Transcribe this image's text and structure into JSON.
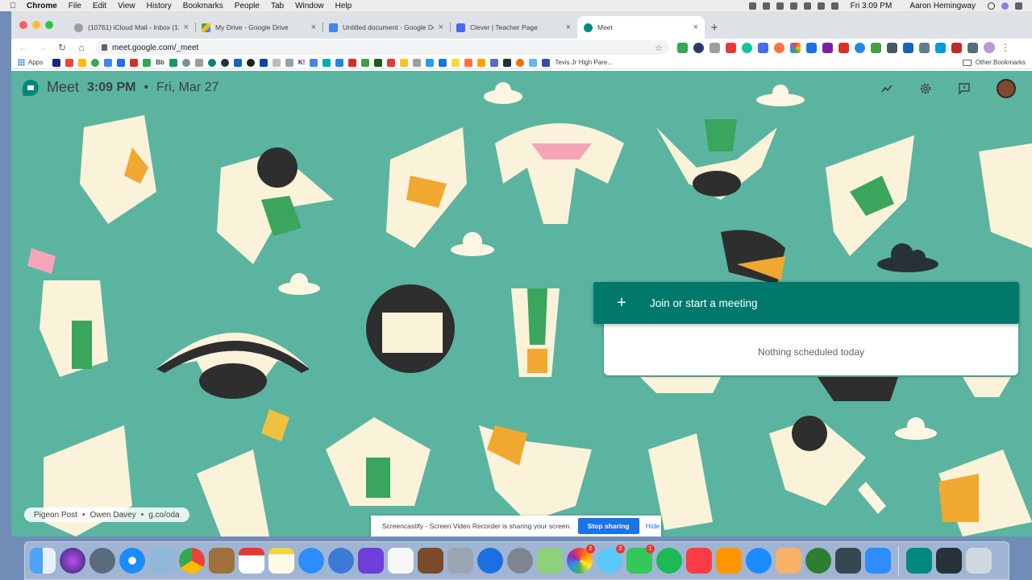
{
  "menubar": {
    "apple_icon": "apple-icon",
    "items": [
      "Chrome",
      "File",
      "Edit",
      "View",
      "History",
      "Bookmarks",
      "People",
      "Tab",
      "Window",
      "Help"
    ],
    "clock": "Fri 3:09 PM",
    "user": "Aaron Hemingway"
  },
  "tabs": [
    {
      "title": "(10761) iCloud Mail - Inbox (13",
      "color": "#9e9e9e",
      "icon": "apple-favicon"
    },
    {
      "title": "My Drive - Google Drive",
      "color": "#fbbc04",
      "icon": "drive-favicon"
    },
    {
      "title": "Untitled document - Google Do",
      "color": "#4285f4",
      "icon": "docs-favicon"
    },
    {
      "title": "Clever | Teacher Page",
      "color": "#436cf2",
      "icon": "clever-favicon"
    },
    {
      "title": "Meet",
      "color": "#00897b",
      "icon": "meet-favicon",
      "active": true
    }
  ],
  "toolbar": {
    "url": "meet.google.com/_meet"
  },
  "bookmarks": {
    "apps_label": "Apps",
    "named_label": "Tevis Jr High Pare...",
    "other_label": "Other Bookmarks",
    "bb_label": "Bb",
    "k_label": "K!"
  },
  "meet": {
    "logo_word": "Meet",
    "time": "3:09 PM",
    "separator": "•",
    "date": "Fri, Mar 27",
    "join_label": "Join or start a meeting",
    "nothing_scheduled": "Nothing scheduled today",
    "credit": {
      "title": "Pigeon Post",
      "sep": "•",
      "author": "Owen Davey",
      "link": "g.co/oda"
    }
  },
  "screenshare": {
    "message": "Screencastify - Screen Video Recorder is sharing your screen.",
    "stop_label": "Stop sharing",
    "hide_label": "Hide"
  },
  "dock": {
    "badges": {
      "photos": "2",
      "messages": "2",
      "facetime": "1"
    }
  }
}
